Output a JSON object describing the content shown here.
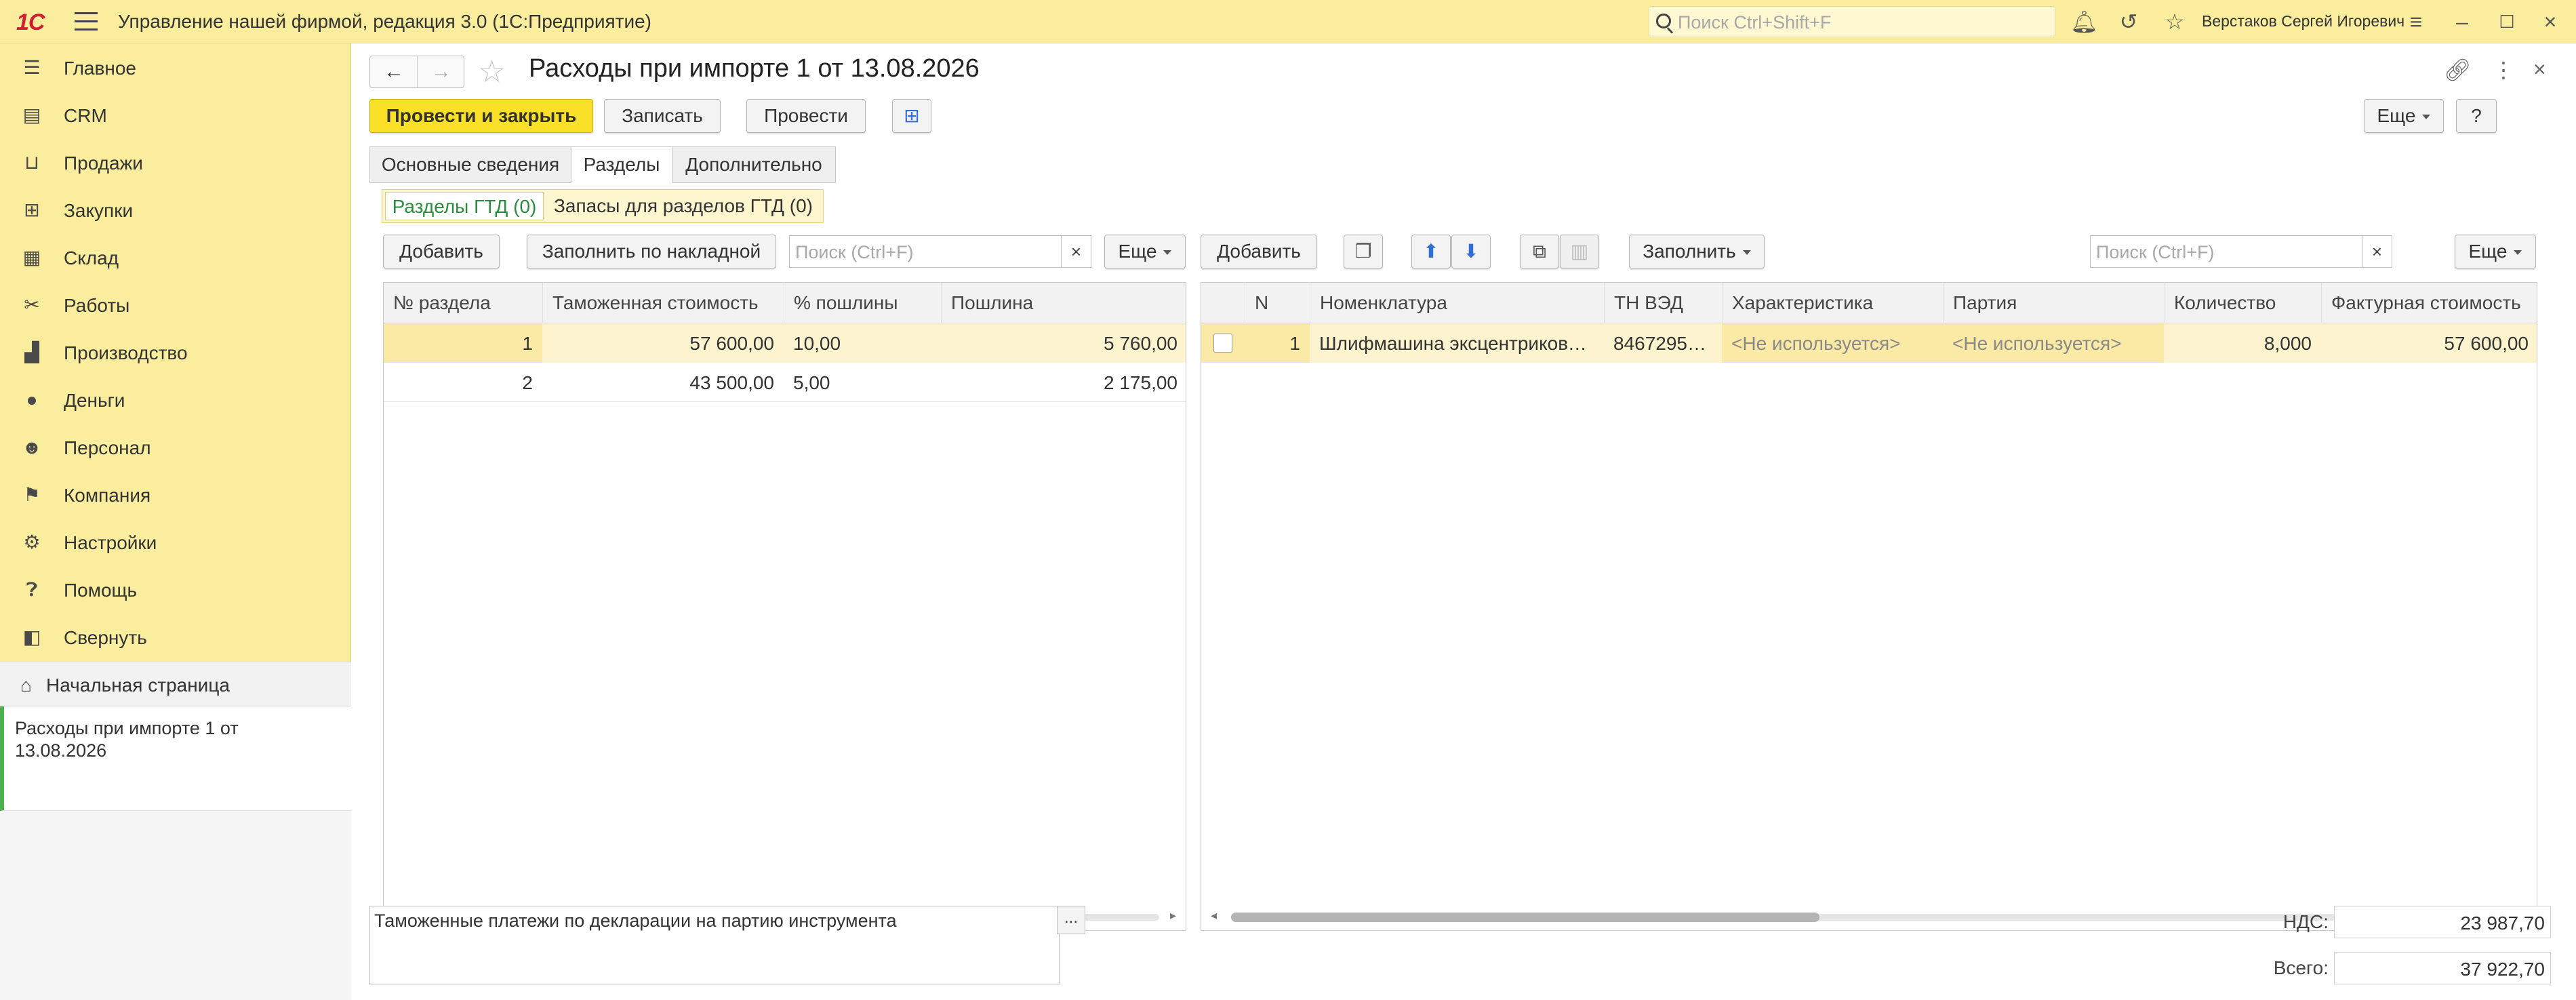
{
  "app": {
    "logo": "1С",
    "title": "Управление нашей фирмой, редакция 3.0  (1С:Предприятие)",
    "search_placeholder": "Поиск Ctrl+Shift+F",
    "user": "Верстаков Сергей Игоревич"
  },
  "sidebar": {
    "items": [
      {
        "label": "Главное",
        "icon": "menu-lines-icon"
      },
      {
        "label": "CRM",
        "icon": "crm-card-icon"
      },
      {
        "label": "Продажи",
        "icon": "basket-icon"
      },
      {
        "label": "Закупки",
        "icon": "cart-icon"
      },
      {
        "label": "Склад",
        "icon": "warehouse-icon"
      },
      {
        "label": "Работы",
        "icon": "tools-icon"
      },
      {
        "label": "Производство",
        "icon": "factory-icon"
      },
      {
        "label": "Деньги",
        "icon": "money-icon"
      },
      {
        "label": "Персонал",
        "icon": "people-icon"
      },
      {
        "label": "Компания",
        "icon": "flag-icon"
      },
      {
        "label": "Настройки",
        "icon": "gear-icon"
      },
      {
        "label": "Помощь",
        "icon": "help-icon"
      },
      {
        "label": "Свернуть",
        "icon": "collapse-panel-icon"
      }
    ],
    "home": "Начальная страница",
    "open_doc": "Расходы при импорте 1 от 13.08.2026"
  },
  "document": {
    "title": "Расходы при импорте 1 от 13.08.2026",
    "buttons": {
      "post_close": "Провести и закрыть",
      "save": "Записать",
      "post": "Провести",
      "more": "Еще",
      "help": "?"
    },
    "tabs": [
      "Основные сведения",
      "Разделы",
      "Дополнительно"
    ],
    "subtabs": [
      "Разделы ГТД (0)",
      "Запасы для разделов ГТД (0)"
    ]
  },
  "left_table": {
    "add": "Добавить",
    "fill_invoice": "Заполнить по накладной",
    "search_placeholder": "Поиск (Ctrl+F)",
    "clear": "×",
    "more": "Еще",
    "columns": [
      "№ раздела",
      "Таможенная стоимость",
      "% пошлины",
      "Пошлина"
    ],
    "rows": [
      [
        "1",
        "57 600,00",
        "10,00",
        "5 760,00"
      ],
      [
        "2",
        "43 500,00",
        "5,00",
        "2 175,00"
      ]
    ]
  },
  "right_table": {
    "add": "Добавить",
    "fill": "Заполнить",
    "search_placeholder": "Поиск (Ctrl+F)",
    "clear": "×",
    "more": "Еще",
    "columns": [
      "N",
      "Номенклатура",
      "ТН ВЭД",
      "Характеристика",
      "Партия",
      "Количество",
      "Фактурная стоимость"
    ],
    "rows": [
      [
        "1",
        "Шлифмашина эксцентриковая…",
        "8467295…",
        "<Не используется>",
        "<Не используется>",
        "8,000",
        "57 600,00"
      ]
    ]
  },
  "footer": {
    "comment": "Таможенные платежи по декларации на партию инструмента",
    "comment_btn": "...",
    "vat_label": "НДС:",
    "vat": "23 987,70",
    "total_label": "Всего:",
    "total": "37 922,70"
  }
}
